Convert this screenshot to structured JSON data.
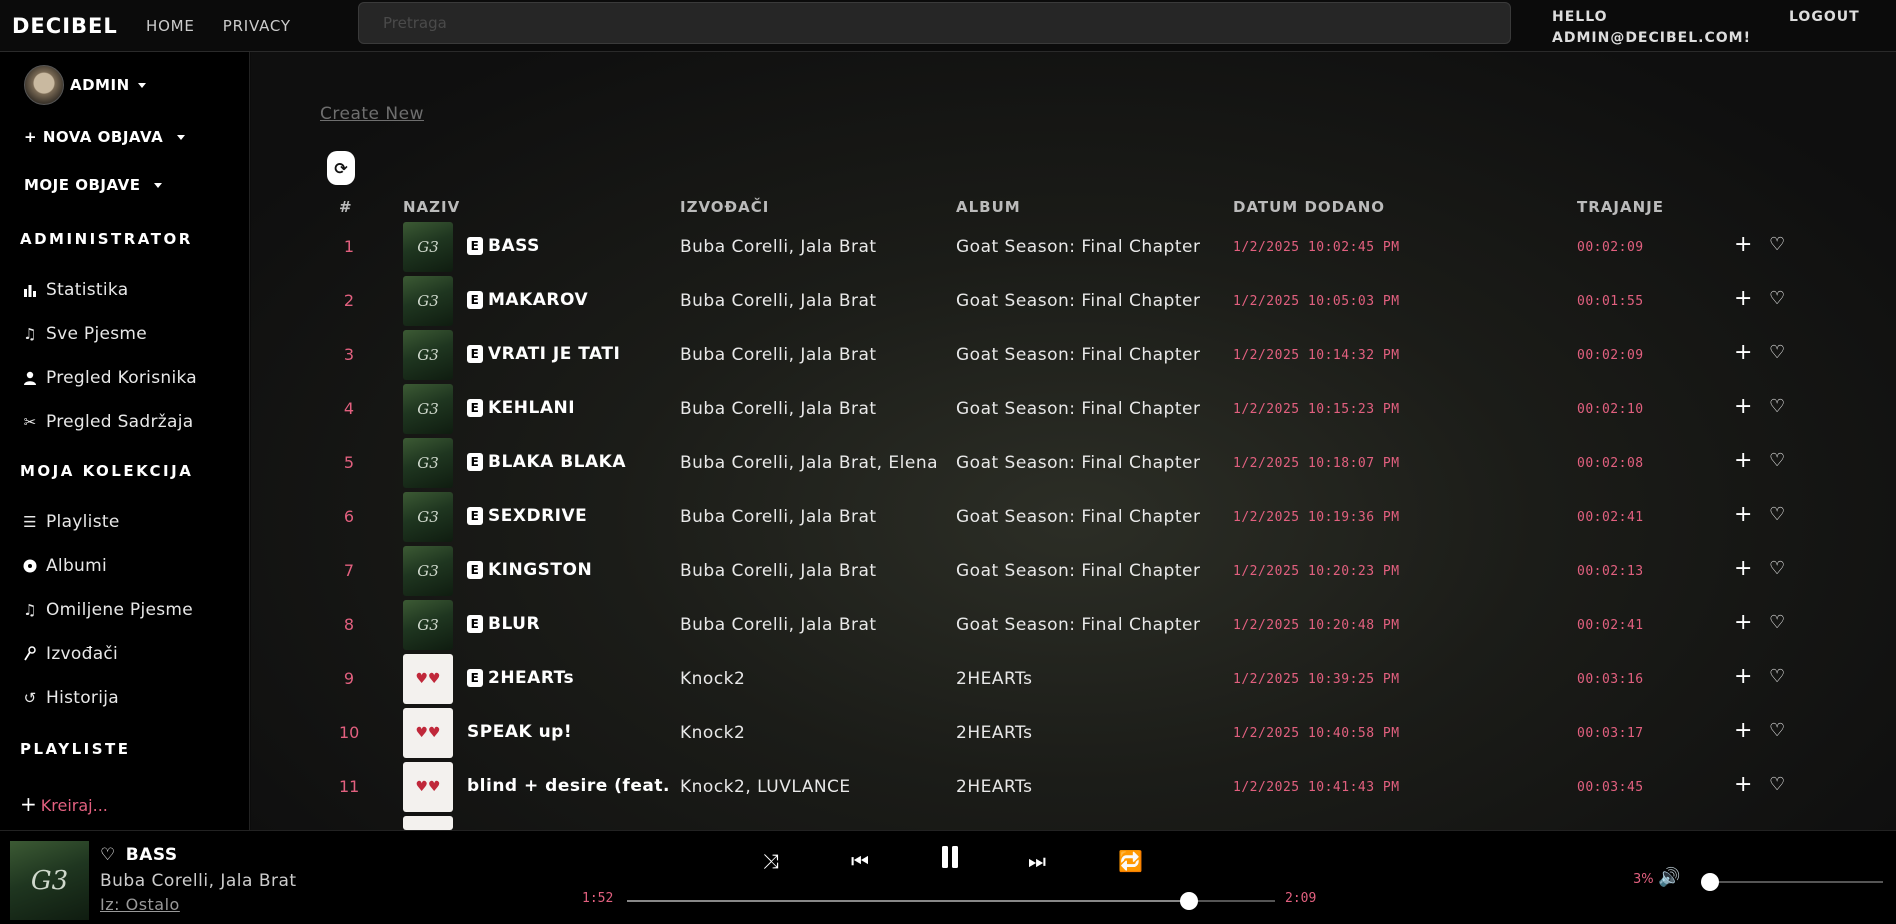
{
  "nav": {
    "brand": "DECIBEL",
    "home": "HOME",
    "privacy": "PRIVACY",
    "search_placeholder": "Pretraga",
    "hello_line1": "HELLO",
    "hello_line2": "ADMIN@DECIBEL.COM!",
    "logout": "LOGOUT"
  },
  "sidebar": {
    "user": "ADMIN",
    "nova_objava": "NOVA OBJAVA",
    "moje_objave": "MOJE OBJAVE",
    "admin_heading": "ADMINISTRATOR",
    "admin_items": [
      {
        "label": "Statistika",
        "icon": "bar-chart-icon"
      },
      {
        "label": "Sve Pjesme",
        "icon": "music-note-icon"
      },
      {
        "label": "Pregled Korisnika",
        "icon": "user-icon"
      },
      {
        "label": "Pregled Sadržaja",
        "icon": "tools-icon"
      }
    ],
    "collection_heading": "MOJA KOLEKCIJA",
    "collection_items": [
      {
        "label": "Playliste",
        "icon": "list-icon"
      },
      {
        "label": "Albumi",
        "icon": "disc-icon"
      },
      {
        "label": "Omiljene Pjesme",
        "icon": "music-note-icon"
      },
      {
        "label": "Izvođači",
        "icon": "microphone-icon"
      },
      {
        "label": "Historija",
        "icon": "history-icon"
      }
    ],
    "playlists_heading": "PLAYLISTE",
    "kreiraj": "Kreiraj..."
  },
  "main": {
    "create_new": "Create New",
    "columns": {
      "num": "#",
      "title": "NAZIV",
      "artists": "IZVOĐAČI",
      "album": "ALBUM",
      "date": "DATUM DODANO",
      "duration": "TRAJANJE"
    },
    "rows": [
      {
        "num": "1",
        "title": "BASS",
        "explicit": true,
        "artists": "Buba Corelli, Jala Brat",
        "album": "Goat Season: Final Chapter",
        "date": "1/2/2025 10:02:45 PM",
        "duration": "00:02:09",
        "art": "goat"
      },
      {
        "num": "2",
        "title": "MAKAROV",
        "explicit": true,
        "artists": "Buba Corelli, Jala Brat",
        "album": "Goat Season: Final Chapter",
        "date": "1/2/2025 10:05:03 PM",
        "duration": "00:01:55",
        "art": "goat"
      },
      {
        "num": "3",
        "title": "VRATI JE TATI",
        "explicit": true,
        "artists": "Buba Corelli, Jala Brat",
        "album": "Goat Season: Final Chapter",
        "date": "1/2/2025 10:14:32 PM",
        "duration": "00:02:09",
        "art": "goat"
      },
      {
        "num": "4",
        "title": "KEHLANI",
        "explicit": true,
        "artists": "Buba Corelli, Jala Brat",
        "album": "Goat Season: Final Chapter",
        "date": "1/2/2025 10:15:23 PM",
        "duration": "00:02:10",
        "art": "goat"
      },
      {
        "num": "5",
        "title": "BLAKA BLAKA",
        "explicit": true,
        "artists": "Buba Corelli, Jala Brat, Elena",
        "album": "Goat Season: Final Chapter",
        "date": "1/2/2025 10:18:07 PM",
        "duration": "00:02:08",
        "art": "goat"
      },
      {
        "num": "6",
        "title": "SEXDRIVE",
        "explicit": true,
        "artists": "Buba Corelli, Jala Brat",
        "album": "Goat Season: Final Chapter",
        "date": "1/2/2025 10:19:36 PM",
        "duration": "00:02:41",
        "art": "goat"
      },
      {
        "num": "7",
        "title": "KINGSTON",
        "explicit": true,
        "artists": "Buba Corelli, Jala Brat",
        "album": "Goat Season: Final Chapter",
        "date": "1/2/2025 10:20:23 PM",
        "duration": "00:02:13",
        "art": "goat"
      },
      {
        "num": "8",
        "title": "BLUR",
        "explicit": true,
        "artists": "Buba Corelli, Jala Brat",
        "album": "Goat Season: Final Chapter",
        "date": "1/2/2025 10:20:48 PM",
        "duration": "00:02:41",
        "art": "goat"
      },
      {
        "num": "9",
        "title": "2HEARTs",
        "explicit": true,
        "artists": "Knock2",
        "album": "2HEARTs",
        "date": "1/2/2025 10:39:25 PM",
        "duration": "00:03:16",
        "art": "hearts"
      },
      {
        "num": "10",
        "title": "SPEAK up!",
        "explicit": false,
        "artists": "Knock2",
        "album": "2HEARTs",
        "date": "1/2/2025 10:40:58 PM",
        "duration": "00:03:17",
        "art": "hearts"
      },
      {
        "num": "11",
        "title": "blind + desire (feat. L...",
        "explicit": false,
        "artists": "Knock2, LUVLANCE",
        "album": "2HEARTs",
        "date": "1/2/2025 10:41:43 PM",
        "duration": "00:03:45",
        "art": "hearts"
      }
    ]
  },
  "player": {
    "title": "BASS",
    "artist": "Buba Corelli, Jala Brat",
    "from": "Iz: Ostalo",
    "current_time": "1:52",
    "total_time": "2:09",
    "progress_fraction": 0.868,
    "volume_label": "3%",
    "volume_fraction": 0.03
  },
  "colors": {
    "accent": "#e2607f"
  }
}
